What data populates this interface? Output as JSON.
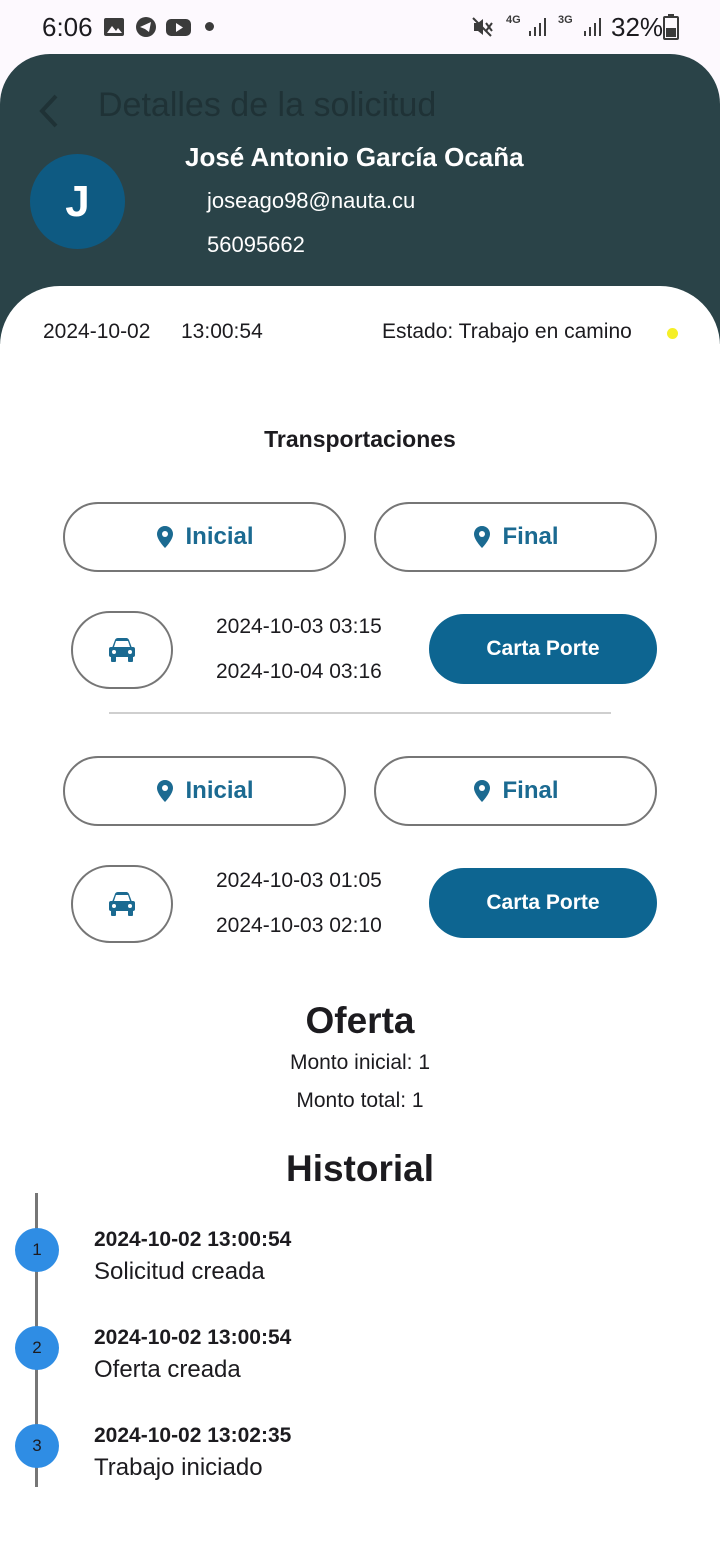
{
  "status_bar": {
    "time": "6:06",
    "battery": "32%",
    "net_4g": "4G",
    "net_3g": "3G"
  },
  "header": {
    "title": "Detalles de la solicitud",
    "avatar_letter": "J",
    "name": "José Antonio García Ocaña",
    "email": "joseago98@nauta.cu",
    "phone": "56095662"
  },
  "request": {
    "date": "2024-10-02",
    "time": "13:00:54",
    "status": "Estado: Trabajo en camino",
    "status_color": "#f5ef27"
  },
  "transportations": {
    "title": "Transportaciones",
    "items": [
      {
        "initial_label": "Inicial",
        "final_label": "Final",
        "start": "2024-10-03 03:15",
        "end": "2024-10-04 03:16",
        "button_label": "Carta Porte"
      },
      {
        "initial_label": "Inicial",
        "final_label": "Final",
        "start": "2024-10-03 01:05",
        "end": "2024-10-03 02:10",
        "button_label": "Carta Porte"
      }
    ]
  },
  "offer": {
    "title": "Oferta",
    "initial_amount": "Monto inicial: 1",
    "total_amount": "Monto total: 1"
  },
  "history": {
    "title": "Historial",
    "items": [
      {
        "step": "1",
        "date": "2024-10-02 13:00:54",
        "text": "Solicitud creada"
      },
      {
        "step": "2",
        "date": "2024-10-02 13:00:54",
        "text": "Oferta creada"
      },
      {
        "step": "3",
        "date": "2024-10-02 13:02:35",
        "text": "Trabajo iniciado"
      }
    ]
  },
  "colors": {
    "header_bg": "#2a4348",
    "avatar_bg": "#0e5a82",
    "primary": "#0d6591",
    "step_circle": "#2f8de4"
  },
  "icons": [
    "image-icon",
    "telegram-icon",
    "youtube-icon",
    "mute-icon",
    "signal-icon",
    "battery-icon",
    "back-arrow-icon",
    "location-pin-icon",
    "car-icon"
  ]
}
